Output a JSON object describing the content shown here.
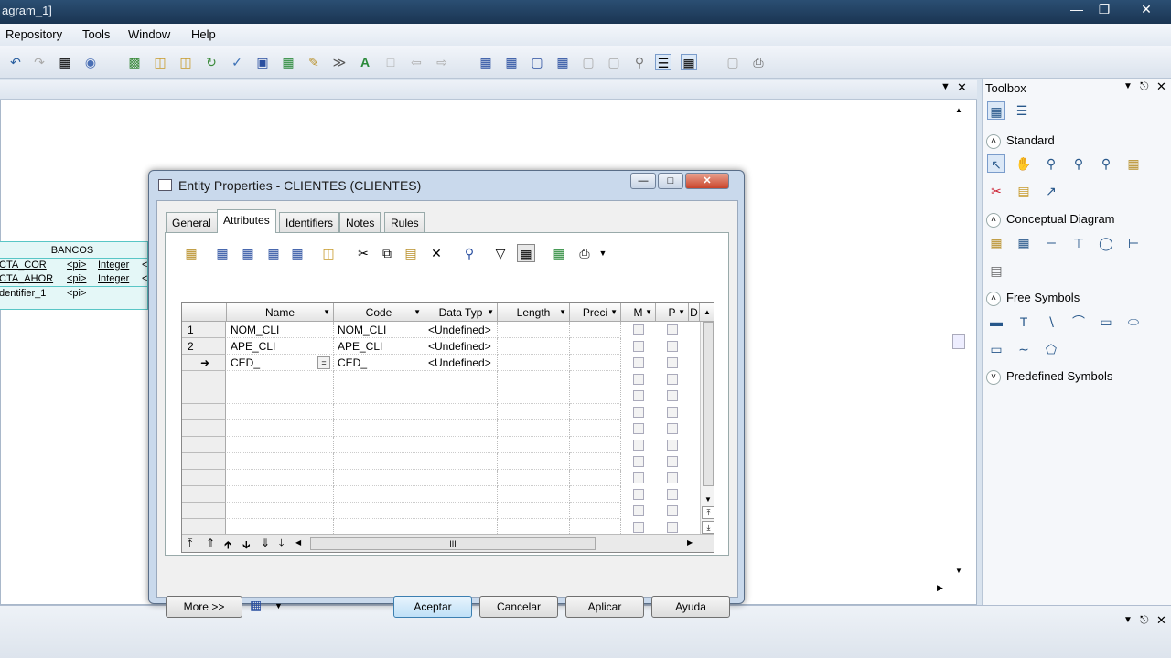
{
  "window": {
    "title": "agram_1]"
  },
  "menu": [
    "Repository",
    "Tools",
    "Window",
    "Help"
  ],
  "diagram": {
    "entity": {
      "name": "BANCOS",
      "rows": [
        {
          "a": "CTA_COR",
          "b": "<pi>",
          "c": "Integer",
          "d": "<"
        },
        {
          "a": "CTA_AHOR",
          "b": "<pi>",
          "c": "Integer",
          "d": "<"
        },
        {
          "a": "dentifier_1",
          "b": "<pi>",
          "c": "",
          "d": ""
        }
      ]
    }
  },
  "toolbox": {
    "title": "Toolbox",
    "sections": [
      "Standard",
      "Conceptual Diagram",
      "Free Symbols",
      "Predefined Symbols"
    ]
  },
  "dialog": {
    "title": "Entity Properties - CLIENTES (CLIENTES)",
    "tabs": [
      "General",
      "Attributes",
      "Identifiers",
      "Notes",
      "Rules"
    ],
    "active_tab": "Attributes",
    "columns": [
      "Name",
      "Code",
      "Data Typ",
      "Length",
      "Preci",
      "M",
      "P",
      "D"
    ],
    "rows": [
      {
        "num": "1",
        "name": "NOM_CLI",
        "code": "NOM_CLI",
        "type": "<Undefined>"
      },
      {
        "num": "2",
        "name": "APE_CLI",
        "code": "APE_CLI",
        "type": "<Undefined>"
      },
      {
        "num": "",
        "name": "CED_",
        "code": "CED_",
        "type": "<Undefined>"
      }
    ],
    "buttons": {
      "more": "More >>",
      "ok": "Aceptar",
      "cancel": "Cancelar",
      "apply": "Aplicar",
      "help": "Ayuda"
    },
    "hscroll_label": "III"
  }
}
